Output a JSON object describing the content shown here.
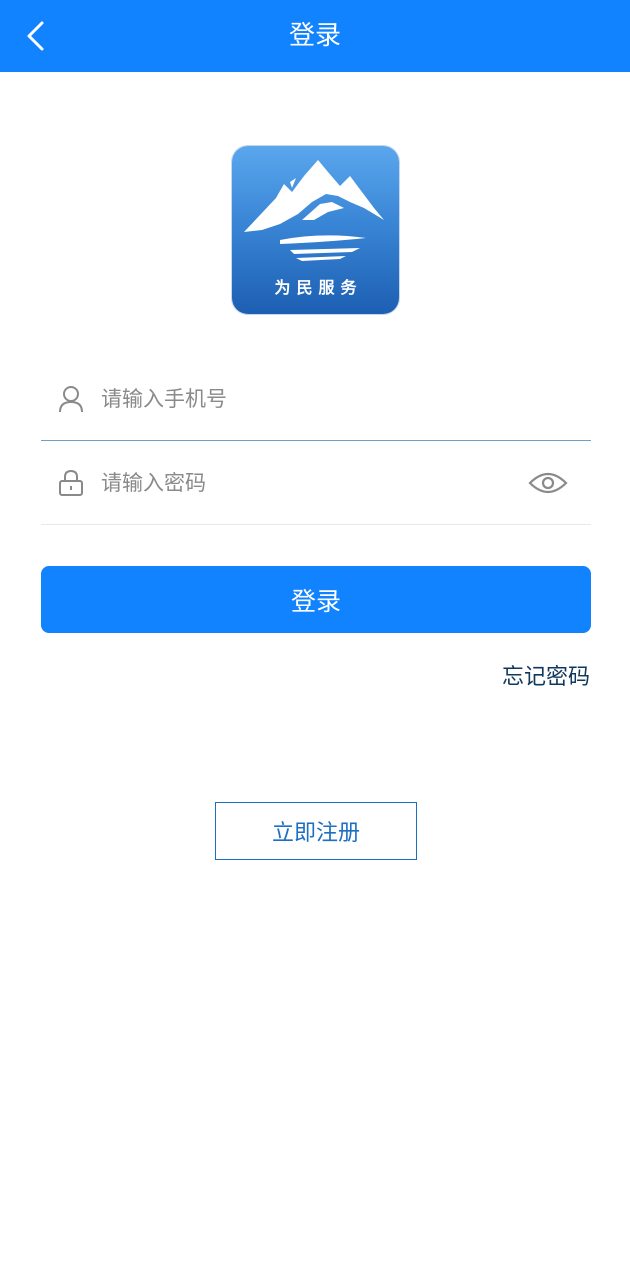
{
  "header": {
    "title": "登录",
    "back_icon": "chevron-left-icon",
    "background_color": "#1283ff"
  },
  "logo": {
    "text": "为民服务",
    "icon": "mountain-logo-icon"
  },
  "form": {
    "phone": {
      "icon": "user-icon",
      "placeholder": "请输入手机号",
      "value": ""
    },
    "password": {
      "icon": "lock-icon",
      "placeholder": "请输入密码",
      "value": "",
      "toggle_icon": "eye-icon"
    }
  },
  "actions": {
    "login_label": "登录",
    "forgot_label": "忘记密码",
    "register_label": "立即注册"
  },
  "colors": {
    "accent": "#1283ff",
    "link": "#10375c",
    "register": "#1d6fc2"
  }
}
